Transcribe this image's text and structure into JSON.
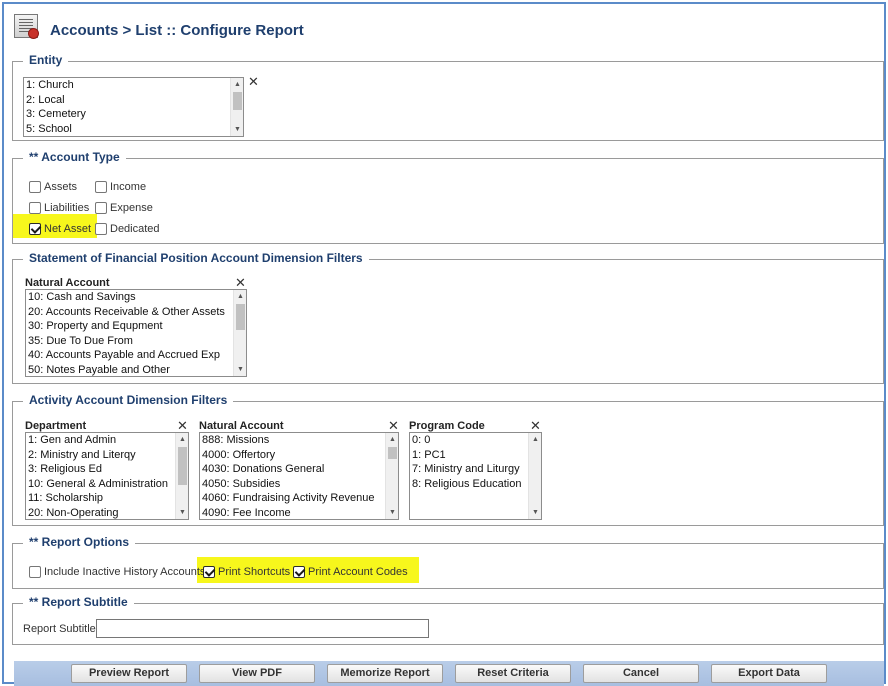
{
  "page": {
    "title": "Accounts > List :: Configure Report"
  },
  "entity": {
    "legend": "Entity",
    "options": [
      "1: Church",
      "2: Local",
      "3: Cemetery",
      "5: School"
    ]
  },
  "account_type": {
    "legend": "** Account Type",
    "items": [
      {
        "label": "Assets",
        "checked": false
      },
      {
        "label": "Income",
        "checked": false
      },
      {
        "label": "Liabilities",
        "checked": false
      },
      {
        "label": "Expense",
        "checked": false
      },
      {
        "label": "Net Asset",
        "checked": true
      },
      {
        "label": "Dedicated",
        "checked": false
      }
    ]
  },
  "sfp_filters": {
    "legend": "Statement of Financial Position Account Dimension Filters",
    "natural_account_label": "Natural Account",
    "options": [
      "10: Cash and Savings",
      "20: Accounts Receivable & Other Assets",
      "30: Property and Equpment",
      "35: Due To Due From",
      "40: Accounts Payable and Accrued Exp",
      "50: Notes Payable and Other"
    ]
  },
  "activity_filters": {
    "legend": "Activity Account Dimension Filters",
    "department": {
      "label": "Department",
      "options": [
        "1: Gen and Admin",
        "2: Ministry and Literqy",
        "3: Religious Ed",
        "10: General & Administration",
        "11: Scholarship",
        "20: Non-Operating"
      ]
    },
    "natural_account": {
      "label": "Natural Account",
      "options": [
        "888: Missions",
        "4000: Offertory",
        "4030: Donations General",
        "4050: Subsidies",
        "4060: Fundraising Activity Revenue",
        "4090: Fee Income"
      ]
    },
    "program_code": {
      "label": "Program Code",
      "options": [
        "0: 0",
        "1: PC1",
        "7: Ministry and Liturgy",
        "8: Religious Education"
      ]
    }
  },
  "report_options": {
    "legend": "** Report Options",
    "items": [
      {
        "label": "Include Inactive History Accounts",
        "checked": false
      },
      {
        "label": "Print Shortcuts",
        "checked": true
      },
      {
        "label": "Print Account Codes",
        "checked": true
      }
    ]
  },
  "report_subtitle": {
    "legend": "** Report Subtitle",
    "field_label": "Report Subtitle:",
    "value": ""
  },
  "footer": {
    "buttons": [
      "Preview Report",
      "View PDF",
      "Memorize Report",
      "Reset Criteria",
      "Cancel",
      "Export Data"
    ]
  },
  "colors": {
    "frame_border": "#5b8bc9",
    "title": "#1f3f6e",
    "highlight": "#f7f71c",
    "footer_bar": "#b9cde8"
  },
  "icons": [
    "report-icon",
    "clear-icon",
    "checkbox-icon",
    "scroll-up-icon",
    "scroll-down-icon"
  ]
}
